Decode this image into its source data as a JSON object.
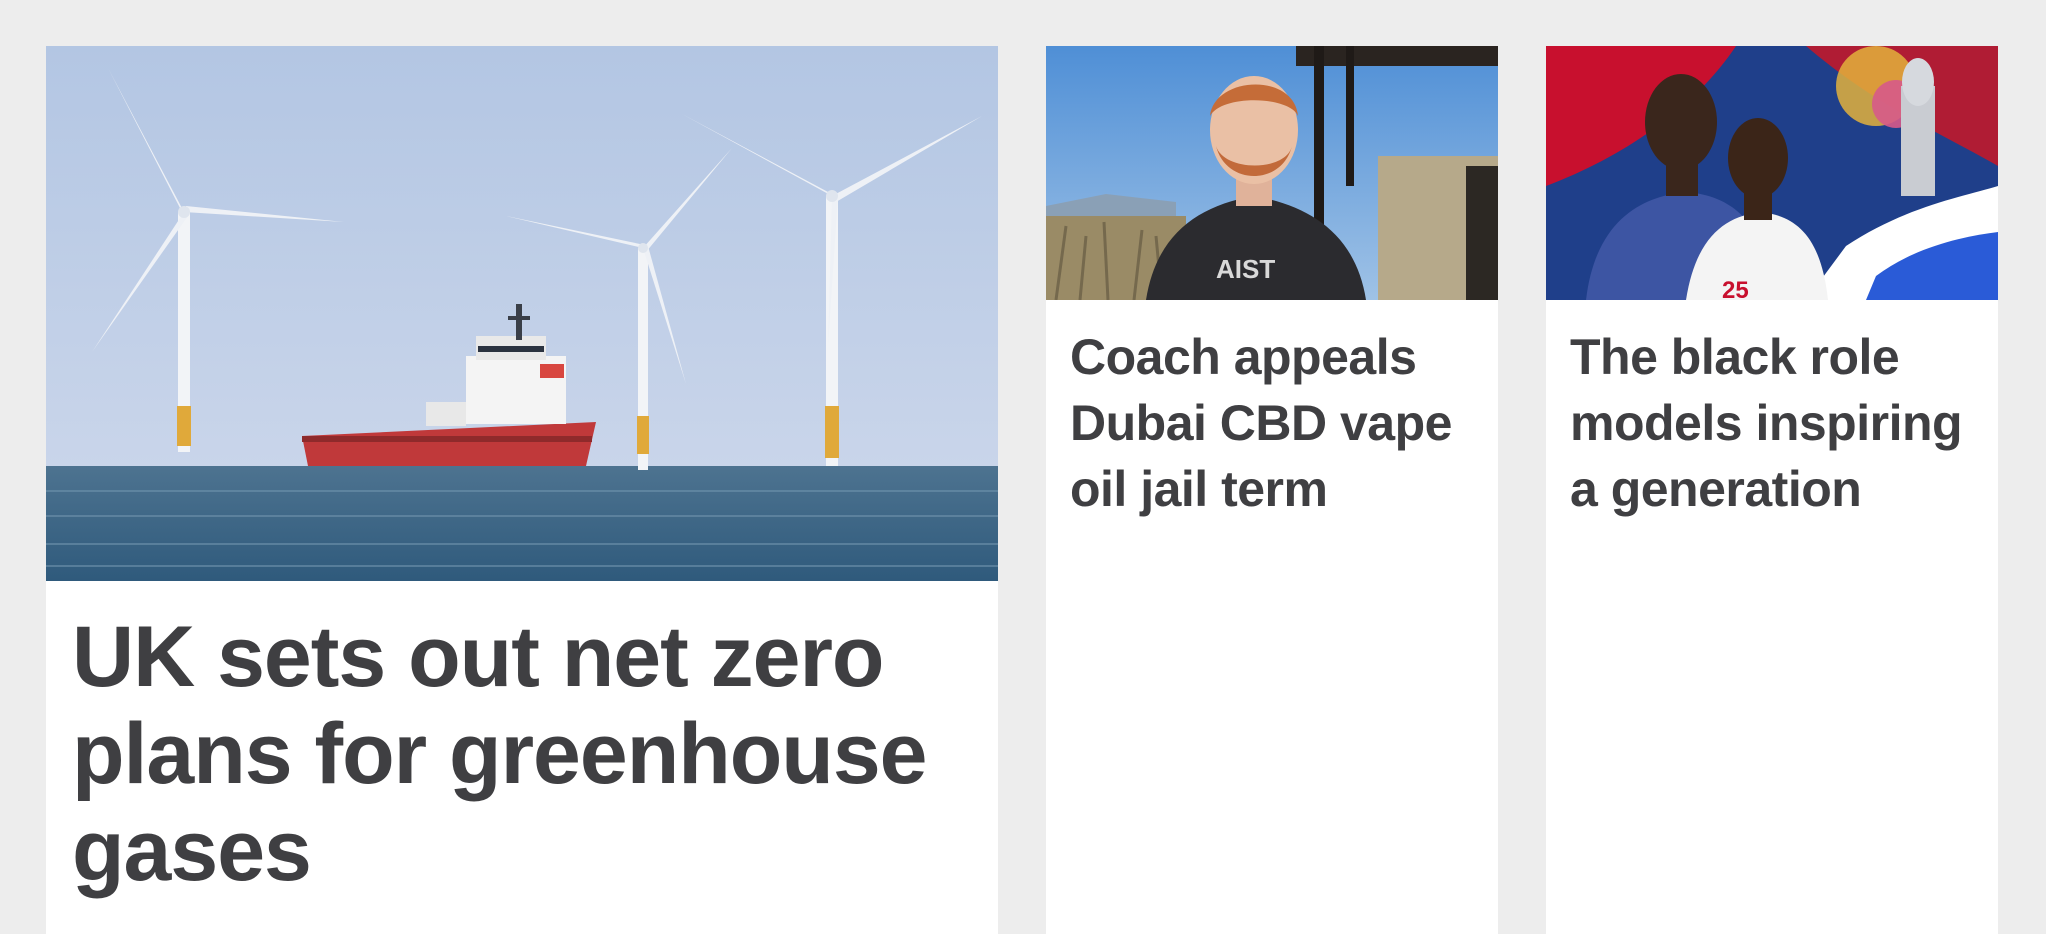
{
  "stories": {
    "main": {
      "headline": "UK sets out net zero plans for greenhouse gases",
      "image": "offshore-wind-farm-image"
    },
    "side_1": {
      "headline": "Coach appeals Dubai CBD vape oil jail term",
      "image": "man-in-hoodie-photo"
    },
    "side_2": {
      "headline": "The black role models inspiring a generation",
      "image": "footballers-illustration"
    }
  },
  "colors": {
    "page_background": "#ededed",
    "card_background": "#ffffff",
    "headline_text": "#3f3f42"
  }
}
